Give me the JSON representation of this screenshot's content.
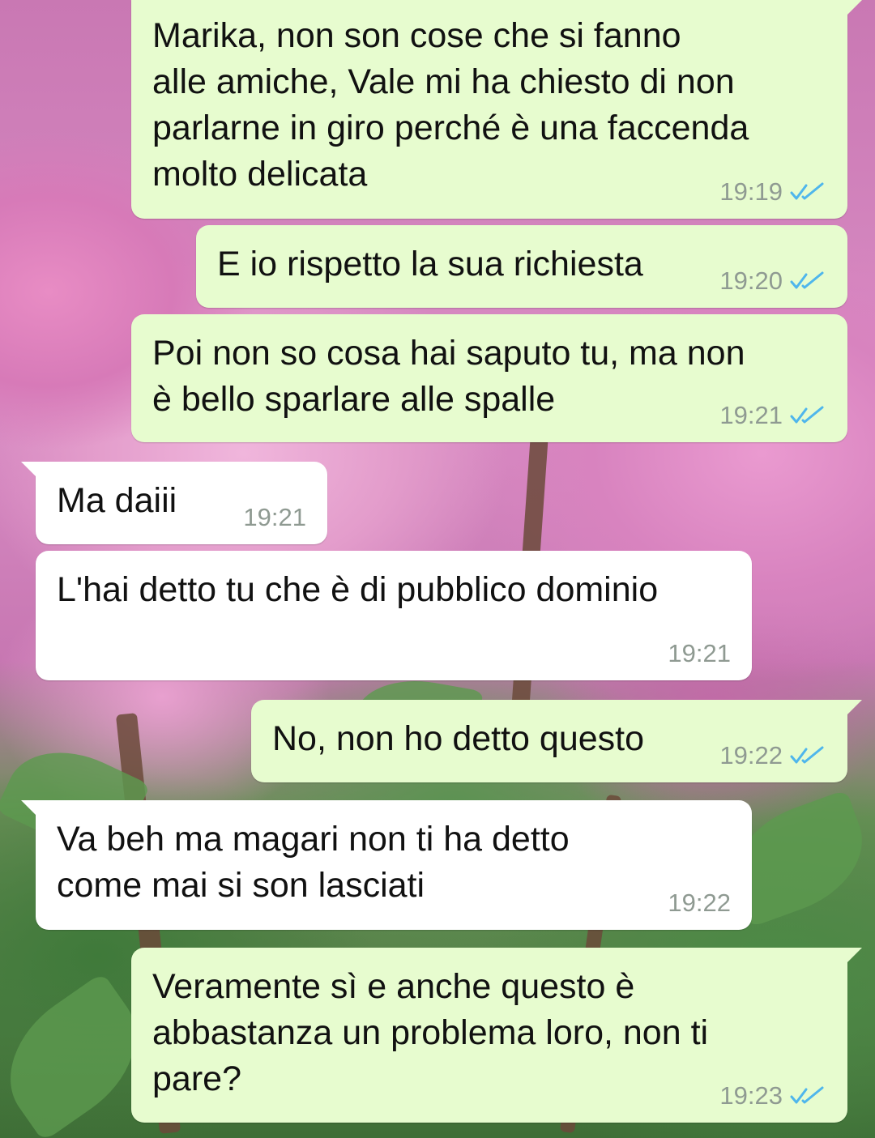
{
  "colors": {
    "outgoing_bubble": "#e7fccf",
    "incoming_bubble": "#ffffff",
    "timestamp": "#8f9a92",
    "read_ticks": "#4fb6ec"
  },
  "wallpaper": {
    "description_icon": "peony-flower-wallpaper"
  },
  "messages": [
    {
      "direction": "outgoing",
      "text": "Marika, non son cose che si fanno\nalle amiche, Vale mi ha chiesto di non\nparlarne in giro perché è una faccenda\nmolto delicata",
      "time": "19:19",
      "status_icon": "double-check-read-icon"
    },
    {
      "direction": "outgoing",
      "text": "E io rispetto la sua richiesta",
      "time": "19:20",
      "status_icon": "double-check-read-icon"
    },
    {
      "direction": "outgoing",
      "text": "Poi non so cosa hai saputo tu, ma non\nè bello sparlare alle spalle",
      "time": "19:21",
      "status_icon": "double-check-read-icon"
    },
    {
      "direction": "incoming",
      "text": "Ma daiii",
      "time": "19:21"
    },
    {
      "direction": "incoming",
      "text": "L'hai detto tu che è di pubblico dominio",
      "time": "19:21"
    },
    {
      "direction": "outgoing",
      "text": "No, non ho detto questo",
      "time": "19:22",
      "status_icon": "double-check-read-icon"
    },
    {
      "direction": "incoming",
      "text": "Va beh ma magari non ti ha detto\ncome mai si son lasciati",
      "time": "19:22"
    },
    {
      "direction": "outgoing",
      "text": "Veramente sì e anche questo è\nabbastanza un problema loro, non ti\npare?",
      "time": "19:23",
      "status_icon": "double-check-read-icon"
    }
  ]
}
